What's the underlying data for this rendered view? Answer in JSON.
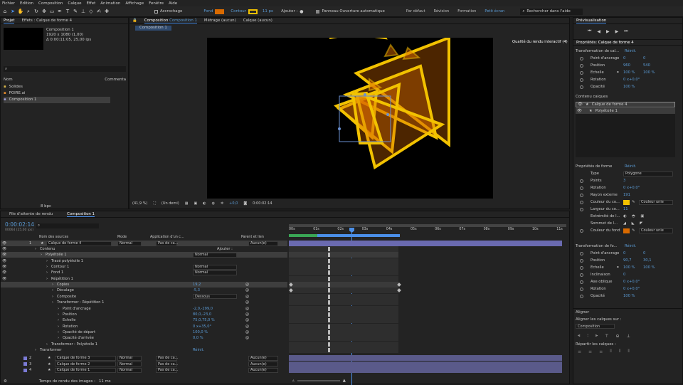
{
  "menu": [
    "Fichier",
    "Edition",
    "Composition",
    "Calque",
    "Effet",
    "Animation",
    "Affichage",
    "Fenêtre",
    "Aide"
  ],
  "toolbar": {
    "snap_label": "Accrochage",
    "fill_label": "Fond",
    "stroke_label": "Contour",
    "stroke_px": "11 px",
    "add_label": "Ajouter :",
    "auto_open_label": "Panneau Ouverture automatique",
    "workspaces": [
      "Par défaut",
      "Révision",
      "Formation",
      "Petit écran"
    ],
    "active_workspace": "Petit écran",
    "search_placeholder": "Rechercher dans l'aide"
  },
  "colors": {
    "accent": "#4b8fe8",
    "fill": "#d96a00",
    "stroke": "#f2c200",
    "track": "#5a5a8a",
    "kf_green": "#3aa655"
  },
  "project": {
    "tab_label": "Projet",
    "effects_tab": "Effets : Calque de forme 4",
    "comp_name": "Composition 1",
    "comp_info1": "1920 x 1080 (1,00)",
    "comp_info2": "Δ 0:00:11:05, 25,00 ips",
    "col_name": "Nom",
    "col_comment": "Commenta",
    "items": [
      "Solides",
      "POIRE.ai",
      "Composition 1"
    ],
    "bpc": "8 bpc"
  },
  "viewer": {
    "tab_comp": "Composition",
    "tab_comp_name": "Composition 1",
    "tab_footage": "Métrage (aucun)",
    "tab_layer": "Calque (aucun)",
    "crumb": "Composition 1",
    "zoom": "(41,9 %)",
    "resolution": "(Un demi)",
    "exposure": "+0,0",
    "timecode": "0:00:02:14"
  },
  "preview": {
    "title": "Prévisualisation",
    "quality": "Qualité du rendu interactif (4)"
  },
  "properties": {
    "title": "Propriétés: Calque de forme 4",
    "transform_title": "Transformation de cal...",
    "reset": "Réinit.",
    "anchor_label": "Point d'ancrage",
    "anchor_x": "0",
    "anchor_y": "0",
    "position_label": "Position",
    "position_x": "960",
    "position_y": "540",
    "scale_label": "Echelle",
    "scale_x": "100 %",
    "scale_y": "100 %",
    "rotation_label": "Rotation",
    "rotation": "0 x+0,0°",
    "opacity_label": "Opacité",
    "opacity": "100 %",
    "layer_content_title": "Contenu calques",
    "content_items": [
      "Calque de forme 4",
      "Polyétoile 1"
    ],
    "shape_props_title": "Propriétés de forme",
    "type_label": "Type",
    "type_value": "Polygone",
    "points_label": "Points",
    "points": "3",
    "shape_rotation_label": "Rotation",
    "shape_rotation": "0 x+0,0°",
    "outer_radius_label": "Rayon externe",
    "outer_radius": "191",
    "stroke_color_label": "Couleur du co...",
    "stroke_mode": "Couleur unie",
    "stroke_width_label": "Largeur du co...",
    "stroke_width": "11",
    "line_cap_label": "Extrémité de l...",
    "line_join_label": "Sommet de l...",
    "fill_color_label": "Couleur du fond",
    "fill_mode": "Couleur unie",
    "shape_transform_title": "Transformation de fo...",
    "s_anchor_label": "Point d'ancrage",
    "s_anchor_x": "0",
    "s_anchor_y": "0",
    "s_position_label": "Position",
    "s_position_x": "90,7",
    "s_position_y": "30,1",
    "s_scale_label": "Echelle",
    "s_scale_x": "100 %",
    "s_scale_y": "100 %",
    "s_skew_label": "Inclinaison",
    "s_skew": "0",
    "s_skew_axis_label": "Axe oblique",
    "s_skew_axis": "0 x+0,0°",
    "s_rotation_label": "Rotation",
    "s_rotation": "0 x+0,0°",
    "s_opacity_label": "Opacité",
    "s_opacity": "100 %"
  },
  "align": {
    "title": "Aligner",
    "align_to": "Aligner les calques sur :",
    "target": "Composition",
    "distribute": "Répartir les calques :"
  },
  "timeline": {
    "tab_render": "File d'attente de rendu",
    "tab_comp": "Composition 1",
    "timecode": "0:00:02:14",
    "frame_info": "00064 (25,00 ips)",
    "col_source": "Nom des sources",
    "col_mode": "Mode",
    "col_track": "Application d'un c...",
    "col_parent": "Parent et lien",
    "ruler": [
      "00s",
      "01s",
      "02s",
      "03s",
      "04s",
      "05s",
      "06s",
      "07s",
      "08s",
      "09s",
      "10s",
      "11s"
    ],
    "add_label": "Ajouter :",
    "reset": "Réinit.",
    "render_time_label": "Temps de rendu des images :",
    "render_time": "11 ms",
    "layer4": {
      "num": "1",
      "name": "Calque de forme 4",
      "mode": "Normal",
      "track": "Pas de ca...",
      "parent": "Aucun(e)"
    },
    "rows": [
      {
        "label": "Contenu",
        "indent": 1,
        "value": "",
        "hl": false
      },
      {
        "label": "Polyétoile 1",
        "indent": 2,
        "value": "Normal",
        "hl": true
      },
      {
        "label": "Tracé polyétoile 1",
        "indent": 3,
        "value": "",
        "hl": false
      },
      {
        "label": "Contour 1",
        "indent": 3,
        "value": "Normal",
        "hl": false
      },
      {
        "label": "Fond 1",
        "indent": 3,
        "value": "Normal",
        "hl": false
      },
      {
        "label": "Répétition 1",
        "indent": 3,
        "value": "",
        "hl": false
      },
      {
        "label": "Copies",
        "indent": 4,
        "value": "19,2",
        "hl": true
      },
      {
        "label": "Décalage",
        "indent": 4,
        "value": "-5,3",
        "hl": false
      },
      {
        "label": "Composite",
        "indent": 4,
        "value": "Dessous",
        "hl": false
      },
      {
        "label": "Transformer : Répétition 1",
        "indent": 4,
        "value": "",
        "hl": false
      },
      {
        "label": "Point d'ancrage",
        "indent": 5,
        "value": "-2,0,-299,0",
        "hl": false
      },
      {
        "label": "Position",
        "indent": 5,
        "value": "80,0,-23,0",
        "hl": false
      },
      {
        "label": "Echelle",
        "indent": 5,
        "value": "75,0,75,0 %",
        "hl": false
      },
      {
        "label": "Rotation",
        "indent": 5,
        "value": "0 x+35,0°",
        "hl": false
      },
      {
        "label": "Opacité de départ",
        "indent": 5,
        "value": "100,0 %",
        "hl": false
      },
      {
        "label": "Opacité d'arrivée",
        "indent": 5,
        "value": "0,0 %",
        "hl": false
      },
      {
        "label": "Transformer : Polyétoile 1",
        "indent": 3,
        "value": "",
        "hl": false
      },
      {
        "label": "Transformer",
        "indent": 1,
        "value": "",
        "hl": false
      }
    ],
    "other_layers": [
      {
        "num": "2",
        "name": "Calque de forme 3",
        "mode": "Normal",
        "track": "Pas de ca...",
        "parent": "Aucun(e)"
      },
      {
        "num": "3",
        "name": "Calque de forme 2",
        "mode": "Normal",
        "track": "Pas de ca...",
        "parent": "Aucun(e)"
      },
      {
        "num": "4",
        "name": "Calque de forme 1",
        "mode": "Normal",
        "track": "Pas de ca...",
        "parent": "Aucun(e)"
      }
    ]
  }
}
